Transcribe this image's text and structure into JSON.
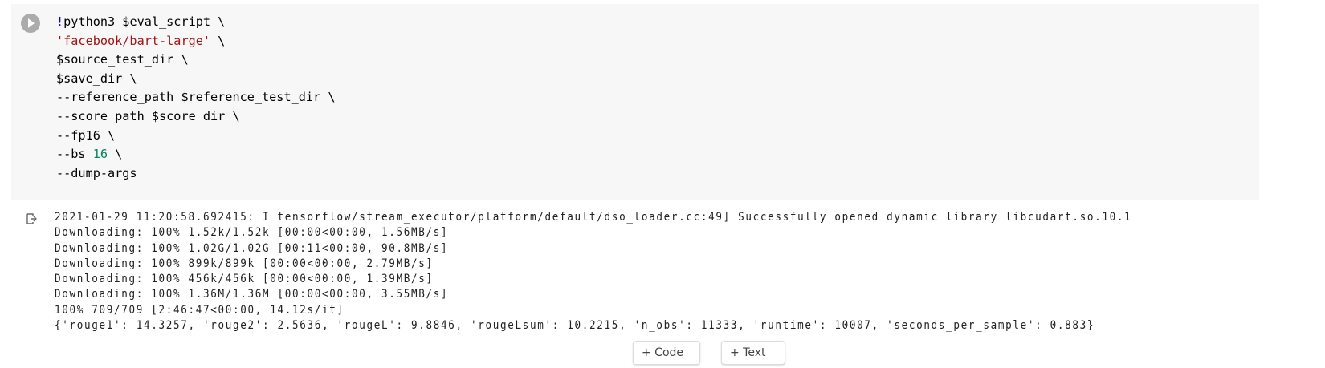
{
  "code_cell": {
    "lines": [
      {
        "prefix": "!",
        "text": "python3 $eval_script \\"
      },
      {
        "str": "'facebook/bart-large'",
        "text": " \\"
      },
      {
        "text": "$source_test_dir \\"
      },
      {
        "text": "$save_dir \\"
      },
      {
        "text": "--reference_path $reference_test_dir \\"
      },
      {
        "text": "--score_path $score_dir \\"
      },
      {
        "text": "--fp16 \\"
      },
      {
        "text": "--bs ",
        "num": "16",
        "tail": " \\"
      },
      {
        "text": "--dump-args"
      }
    ]
  },
  "output": {
    "lines": [
      "2021-01-29 11:20:58.692415: I tensorflow/stream_executor/platform/default/dso_loader.cc:49] Successfully opened dynamic library libcudart.so.10.1",
      "Downloading: 100% 1.52k/1.52k [00:00<00:00, 1.56MB/s]",
      "Downloading: 100% 1.02G/1.02G [00:11<00:00, 90.8MB/s]",
      "Downloading: 100% 899k/899k [00:00<00:00, 2.79MB/s]",
      "Downloading: 100% 456k/456k [00:00<00:00, 1.39MB/s]",
      "Downloading: 100% 1.36M/1.36M [00:00<00:00, 3.55MB/s]",
      "100% 709/709 [2:46:47<00:00, 14.12s/it]",
      "{'rouge1': 14.3257, 'rouge2': 2.5636, 'rougeL': 9.8846, 'rougeLsum': 10.2215, 'n_obs': 11333, 'runtime': 10007, 'seconds_per_sample': 0.883}"
    ]
  },
  "toolbar": {
    "add_code": "+ Code",
    "add_text": "+ Text"
  }
}
